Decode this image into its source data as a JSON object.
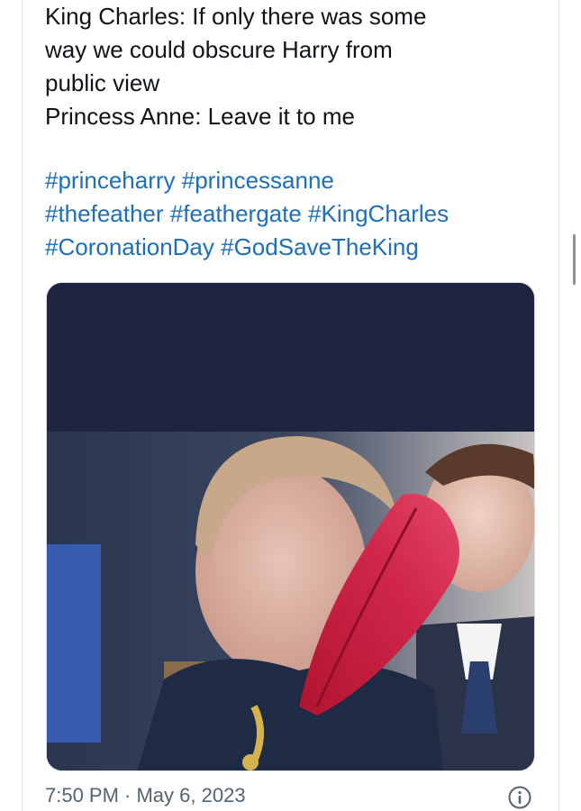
{
  "tweet": {
    "text_lines": [
      "King Charles: If only there was some",
      "way we could obscure Harry from",
      "public view",
      "Princess Anne: Leave it to me"
    ],
    "hashtag_rows": [
      [
        "#princeharry",
        "#princessanne"
      ],
      [
        "#thefeather",
        "#feathergate",
        "#KingCharles"
      ],
      [
        "#CoronationDay",
        "#GodSaveTheKing"
      ]
    ],
    "timestamp": "7:50 PM · May 6, 2023"
  },
  "media": {
    "description_icon": "photo"
  },
  "icons": {
    "info": "info-circle-icon"
  },
  "colors": {
    "hashtag": "#1d6fb8",
    "text": "#0f1419",
    "muted": "#536471",
    "image_band": "#1f2540",
    "feather": "#c8203f"
  }
}
